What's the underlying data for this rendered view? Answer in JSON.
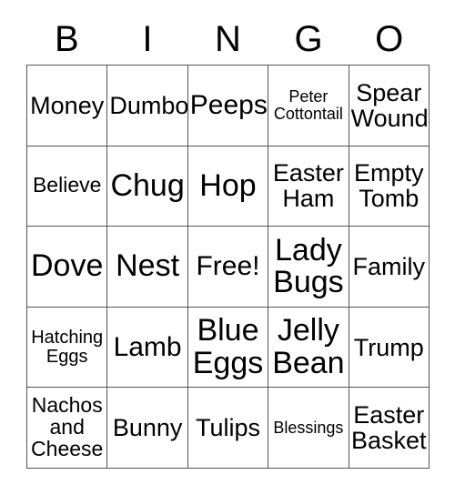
{
  "card": {
    "headers": [
      "B",
      "I",
      "N",
      "G",
      "O"
    ],
    "rows": [
      [
        {
          "text": "Money",
          "size": "md"
        },
        {
          "text": "Dumbo",
          "size": "md"
        },
        {
          "text": "Peeps",
          "size": "lg"
        },
        {
          "text": "Peter Cottontail",
          "size": "xxs"
        },
        {
          "text": "Spear Wound",
          "size": "md"
        }
      ],
      [
        {
          "text": "Believe",
          "size": "sm"
        },
        {
          "text": "Chug",
          "size": "xl"
        },
        {
          "text": "Hop",
          "size": "xl"
        },
        {
          "text": "Easter Ham",
          "size": "md"
        },
        {
          "text": "Empty Tomb",
          "size": "md"
        }
      ],
      [
        {
          "text": "Dove",
          "size": "xl"
        },
        {
          "text": "Nest",
          "size": "xl"
        },
        {
          "text": "Free!",
          "size": "lg"
        },
        {
          "text": "Lady Bugs",
          "size": "xl"
        },
        {
          "text": "Family",
          "size": "md"
        }
      ],
      [
        {
          "text": "Hatching Eggs",
          "size": "xs"
        },
        {
          "text": "Lamb",
          "size": "lg"
        },
        {
          "text": "Blue Eggs",
          "size": "xl"
        },
        {
          "text": "Jelly Bean",
          "size": "xl"
        },
        {
          "text": "Trump",
          "size": "md"
        }
      ],
      [
        {
          "text": "Nachos and Cheese",
          "size": "sm"
        },
        {
          "text": "Bunny",
          "size": "md"
        },
        {
          "text": "Tulips",
          "size": "md"
        },
        {
          "text": "Blessings",
          "size": "xxs"
        },
        {
          "text": "Easter Basket",
          "size": "md"
        }
      ]
    ]
  },
  "colors": {
    "grid_line": "#555555",
    "text": "#000000",
    "background": "#ffffff"
  }
}
